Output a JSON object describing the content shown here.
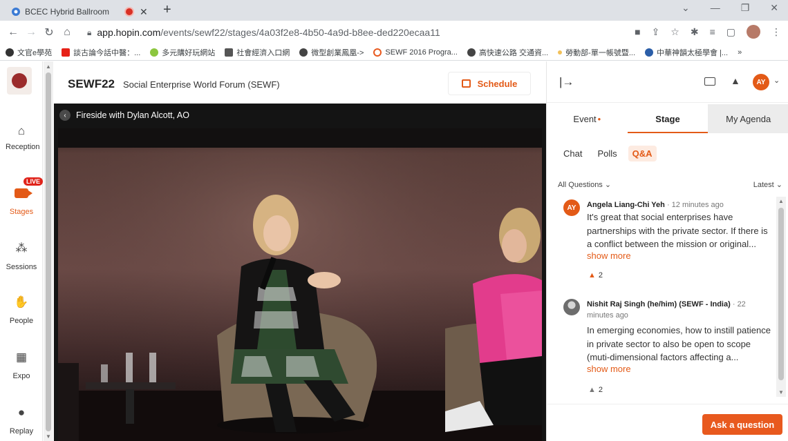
{
  "browser": {
    "tab_title": "BCEC Hybrid Ballroom",
    "url_host": "app.hopin.com",
    "url_path": "/events/sewf22/stages/4a03f2e8-4b50-4a9d-b8ee-ded220ecaa11",
    "bookmarks": [
      "文官e學苑",
      "談古論今話中醫：...",
      "多元購好玩網站",
      "社會經濟入口網",
      "微型創業鳳凰->",
      "SEWF 2016 Progra...",
      "高快速公路 交通資...",
      "勞動部-單一帳號暨...",
      "中華神韻太極學會 |..."
    ]
  },
  "nav": {
    "items": [
      {
        "label": "Reception"
      },
      {
        "label": "Stages"
      },
      {
        "label": "Sessions"
      },
      {
        "label": "People"
      },
      {
        "label": "Expo"
      },
      {
        "label": "Replay"
      }
    ],
    "live_badge": "LIVE"
  },
  "header": {
    "event_short": "SEWF22",
    "event_full": "Social Enterprise World Forum (SEWF)",
    "schedule_label": "Schedule"
  },
  "stage": {
    "session_title": "Fireside with Dylan Alcott, AO"
  },
  "panel": {
    "user_initials": "AY",
    "tabs": [
      {
        "label": "Event",
        "dot": "•"
      },
      {
        "label": "Stage"
      },
      {
        "label": "My Agenda"
      }
    ],
    "subtabs": [
      "Chat",
      "Polls",
      "Q&A"
    ],
    "filter_label": "All Questions",
    "sort_label": "Latest",
    "questions": [
      {
        "author": "Angela Liang-Chi Yeh",
        "time": "· 12 minutes ago",
        "initials": "AY",
        "text": "It's great that social enterprises have partnerships with the private sector. If there is a conflict between the mission or original...",
        "more": "show more",
        "likes": "2"
      },
      {
        "author": "Nishit Raj Singh (he/him) (SEWF - India)",
        "time": "· 22 minutes ago",
        "text": "In emerging economies, how to instill patience in private sector to also be open to scope (muti-dimensional factors affecting a...",
        "more": "show more",
        "likes": "2"
      }
    ],
    "ask_label": "Ask a question"
  },
  "colors": {
    "accent": "#e35a17",
    "live": "#e0241b"
  }
}
